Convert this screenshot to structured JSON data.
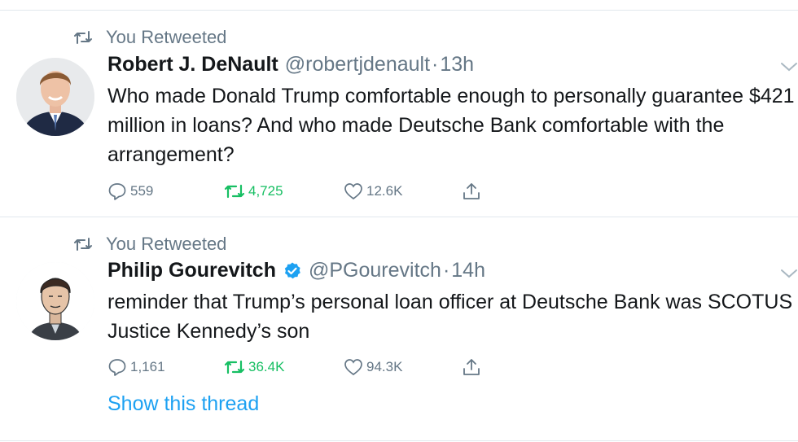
{
  "tweets": [
    {
      "retweet_label": "You Retweeted",
      "name": "Robert J. DeNault",
      "handle": "@robertjdenault",
      "separator": "·",
      "time": "13h",
      "text": "Who made Donald Trump comfortable enough to personally guarantee $421 million in loans? And who made Deutsche Bank comfortable with the arrangement?",
      "replies": "559",
      "retweets": "4,725",
      "likes": "12.6K",
      "verified": false
    },
    {
      "retweet_label": "You Retweeted",
      "name": "Philip Gourevitch",
      "handle": "@PGourevitch",
      "separator": "·",
      "time": "14h",
      "text": "reminder that Trump’s personal loan officer at Deutsche Bank was SCOTUS Justice Kennedy’s son",
      "replies": "1,161",
      "retweets": "36.4K",
      "likes": "94.3K",
      "verified": true,
      "thread_link": "Show this thread"
    }
  ],
  "icons": {
    "retweet": "retweet-icon",
    "reply": "reply-icon",
    "like": "heart-icon",
    "share": "share-icon",
    "verified": "verified-badge-icon",
    "caret": "chevron-down-icon"
  },
  "colors": {
    "text": "#14171a",
    "secondary": "#657786",
    "retweet_green": "#17bf63",
    "link_blue": "#1da1f2",
    "divider": "#e1e8ed"
  }
}
